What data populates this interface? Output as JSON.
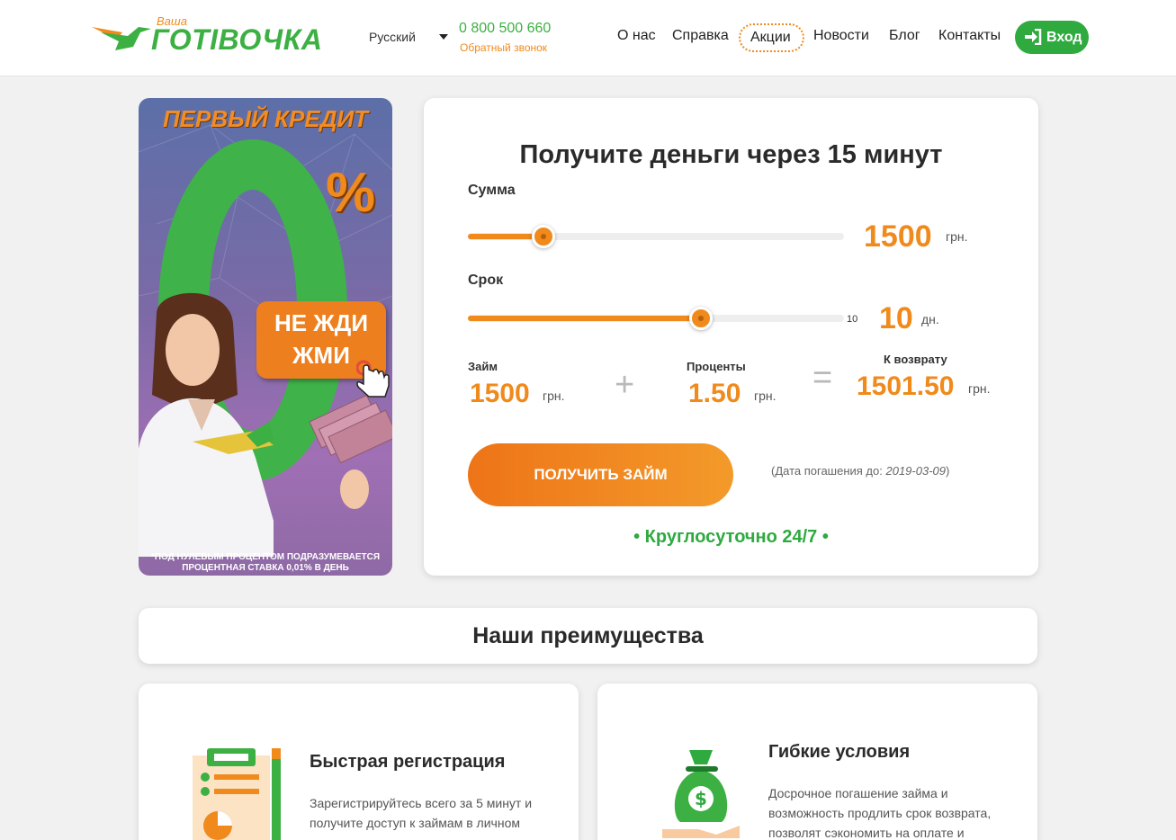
{
  "header": {
    "logo_small": "Ваша",
    "logo_big": "ГОТІВОЧКА",
    "language": "Русский",
    "phone": "0 800 500 660",
    "callback": "Обратный звонок",
    "nav": [
      "О нас",
      "Справка",
      "Акции",
      "Новости",
      "Блог",
      "Контакты"
    ],
    "login": "Вход"
  },
  "promo": {
    "title": "ПЕРВЫЙ КРЕДИТ",
    "percent": "%",
    "btn_line1": "НЕ ЖДИ",
    "btn_line2": "ЖМИ",
    "note_line1": "*ПОД НУЛЕВЫМ ПРОЦЕНТОМ ПОДРАЗУМЕВАЕТСЯ",
    "note_line2": "ПРОЦЕНТНАЯ СТАВКА 0,01% В ДЕНЬ"
  },
  "calculator": {
    "title": "Получите деньги через 15 минут",
    "sum_label": "Сумма",
    "sum_value": "1500",
    "sum_unit": "грн.",
    "sum_fraction": 0.2,
    "term_label": "Срок",
    "term_tick": "10",
    "term_value": "10",
    "term_unit": "дн.",
    "term_fraction": 0.62,
    "loan_label": "Займ",
    "loan_value": "1500",
    "loan_unit": "грн.",
    "plus": "+",
    "interest_label": "Проценты",
    "interest_value": "1.50",
    "interest_unit": "грн.",
    "equals": "=",
    "return_label": "К возврату",
    "return_value": "1501.50",
    "return_unit": "грн.",
    "button": "ПОЛУЧИТЬ ЗАЙМ",
    "due_prefix": "(Дата погашения до: ",
    "due_date": "2019-03-09",
    "due_suffix": ")",
    "round_clock": "•  Круглосуточно 24/7  •"
  },
  "advantages": {
    "heading": "Наши преимущества",
    "items": [
      {
        "title": "Быстрая регистрация",
        "text_line1": "Зарегистрируйтесь всего за 5 минут и",
        "text_line2": "получите доступ к займам в личном"
      },
      {
        "title": "Гибкие условия",
        "text_line1": "Досрочное погашение займа и",
        "text_line2": "возможность продлить срок возврата,",
        "text_line3": "позволят сэкономить на оплате и"
      }
    ]
  },
  "colors": {
    "brand_green": "#3cb043",
    "brand_orange": "#f08a1c",
    "login_green": "#2eaa3f"
  },
  "icons": [
    "logo-bird-icon",
    "caret-down-icon",
    "login-icon",
    "pointer-hand-icon",
    "registration-icon",
    "money-bag-icon"
  ]
}
